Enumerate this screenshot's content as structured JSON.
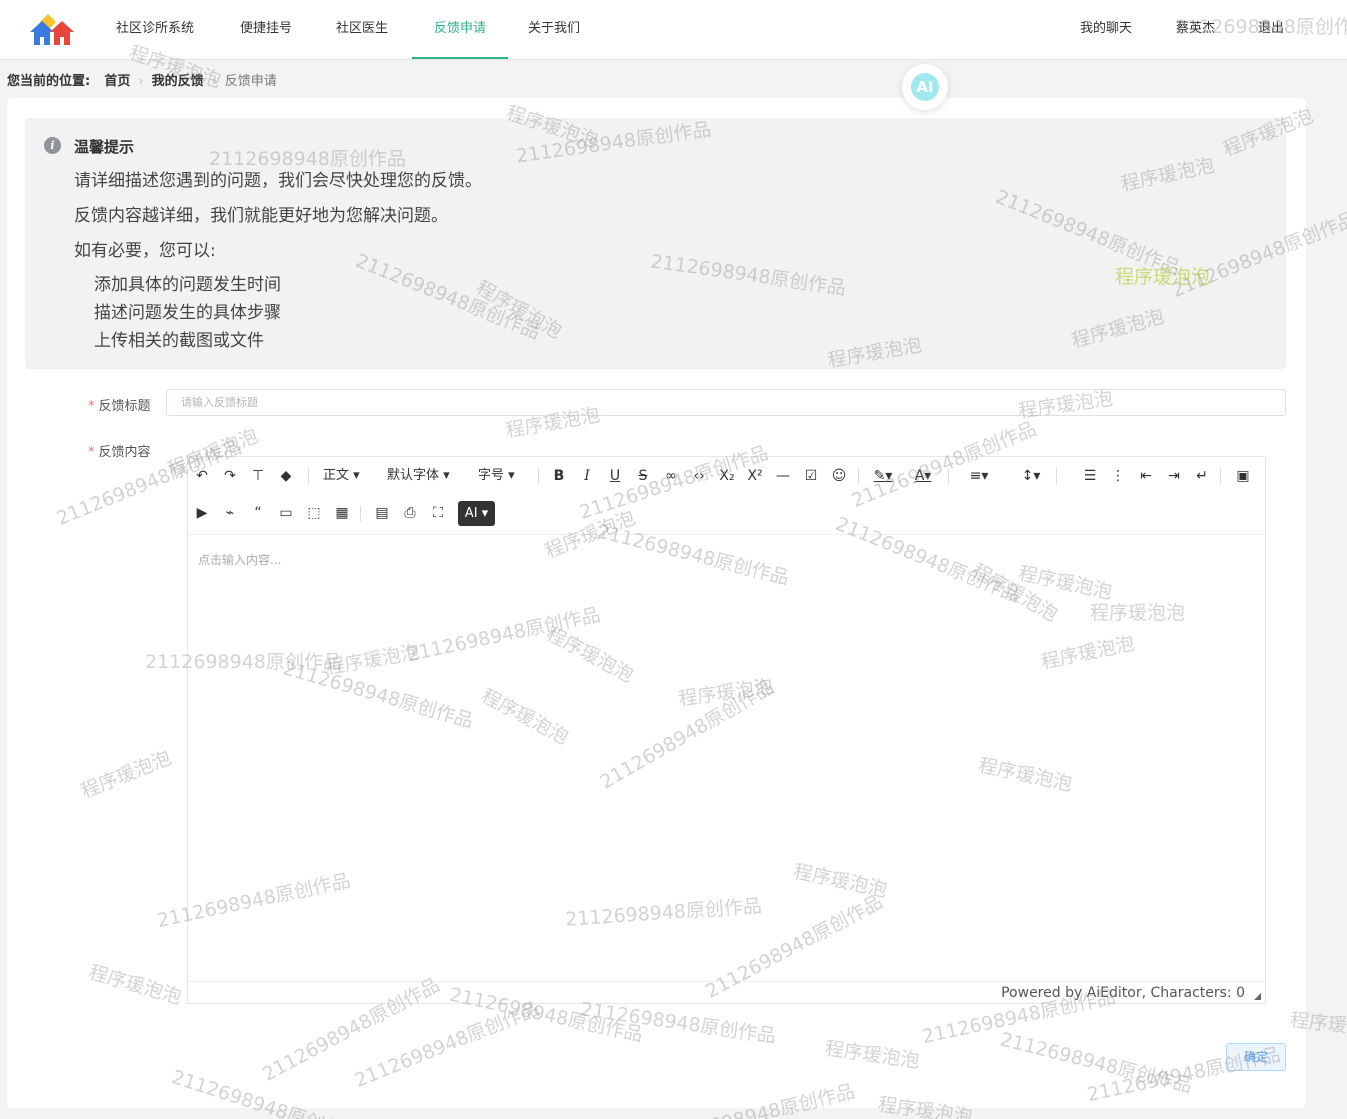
{
  "nav": {
    "items": [
      "社区诊所系统",
      "便捷挂号",
      "社区医生",
      "反馈申请",
      "关于我们"
    ],
    "active_index": 3,
    "right": [
      "我的聊天",
      "蔡英杰",
      "退出"
    ]
  },
  "breadcrumb": {
    "label": "您当前的位置:",
    "items": [
      "首页",
      "我的反馈",
      "反馈申请"
    ]
  },
  "ai_bubble": "AI",
  "tip": {
    "title": "温馨提示",
    "lines": [
      "请详细描述您遇到的问题，我们会尽快处理您的反馈。",
      "反馈内容越详细，我们就能更好地为您解决问题。",
      "如有必要，您可以:"
    ],
    "subs": [
      "添加具体的问题发生时间",
      "描述问题发生的具体步骤",
      "上传相关的截图或文件"
    ]
  },
  "form": {
    "title_label": "反馈标题",
    "title_placeholder": "请输入反馈标题",
    "content_label": "反馈内容",
    "confirm": "确定"
  },
  "editor": {
    "toolbar_text": [
      "正文",
      "默认字体",
      "字号"
    ],
    "ai_label": "AI",
    "placeholder": "点击输入内容...",
    "footer": "Powered by AiEditor, Characters: 0"
  },
  "watermarks": {
    "text_a": "2112698948原创作品",
    "text_b": "程序瑗泡泡"
  },
  "colors": {
    "accent": "#2fb38a",
    "primary": "#409eff",
    "required": "#f56c6c"
  }
}
